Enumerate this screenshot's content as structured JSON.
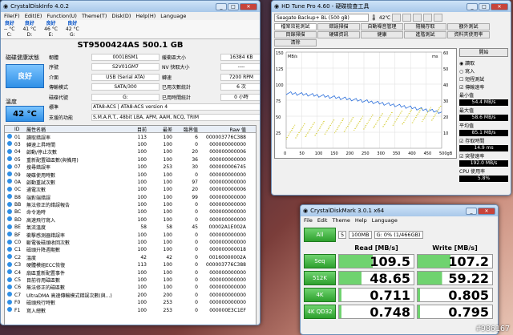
{
  "cdi": {
    "title": "CrystalDiskInfo 4.0.2",
    "menu": [
      "File(F)",
      "Edit(E)",
      "Function(U)",
      "Theme(T)",
      "Disk(D)",
      "Help(H)",
      "Language"
    ],
    "drives": [
      {
        "status": "良好",
        "temp": "-- °C",
        "letter": "C:"
      },
      {
        "status": "良好",
        "temp": "41 °C",
        "letter": "D:"
      },
      {
        "status": "良好",
        "temp": "46 °C",
        "letter": "E:"
      },
      {
        "status": "良好",
        "temp": "42 °C",
        "letter": "G:"
      }
    ],
    "model": "ST9500424AS  500.1 GB",
    "health_label": "磁碟健康狀態",
    "health": "良好",
    "temp_label": "溫度",
    "temp": "42 °C",
    "fields": [
      [
        "韌體",
        "0001BSM1",
        "緩衝區大小",
        "16384 KB"
      ],
      [
        "序號",
        "S2V01GM7",
        "NV 快取大小",
        "----"
      ],
      [
        "介面",
        "USB (Serial ATA)",
        "轉速",
        "7200 RPM"
      ],
      [
        "傳輸模式",
        "SATA/300",
        "已用次數統計",
        "6 次"
      ],
      [
        "磁碟代號",
        "G:",
        "已用時間統計",
        "0 小時"
      ]
    ],
    "standard_label": "標準",
    "standard": "ATA8-ACS | ATA8-ACS version 4",
    "features_label": "支援的功能",
    "features": "S.M.A.R.T., 48bit LBA, APM, AAM, NCQ, TRIM",
    "cols": [
      "",
      "ID",
      "屬性名稱",
      "目前",
      "最差",
      "臨界值",
      "Raw 值"
    ],
    "rows": [
      [
        "01",
        "讀取錯誤率",
        "113",
        "100",
        "6",
        "000003776C388"
      ],
      [
        "03",
        "轉速上昇時間",
        "100",
        "100",
        "0",
        "000000000000"
      ],
      [
        "04",
        "啟動/停止次數",
        "100",
        "100",
        "20",
        "000000000006"
      ],
      [
        "05",
        "重新配置磁區數(與備用)",
        "100",
        "100",
        "36",
        "000000000000"
      ],
      [
        "07",
        "搜尋錯誤率",
        "100",
        "253",
        "30",
        "000000006745"
      ],
      [
        "09",
        "硬碟使用時數",
        "100",
        "100",
        "0",
        "000000000000"
      ],
      [
        "0A",
        "啟動重試次數",
        "100",
        "100",
        "97",
        "000000000000"
      ],
      [
        "0C",
        "通電次數",
        "100",
        "100",
        "20",
        "000000000006"
      ],
      [
        "B8",
        "端對端錯誤",
        "100",
        "100",
        "99",
        "000000000000"
      ],
      [
        "BB",
        "無法修正的錯誤報告",
        "100",
        "100",
        "0",
        "000000000000"
      ],
      [
        "BC",
        "命令逾時",
        "100",
        "100",
        "0",
        "000000000000"
      ],
      [
        "BD",
        "高速飛行寫入",
        "100",
        "100",
        "0",
        "000000000000"
      ],
      [
        "BE",
        "氣流溫度",
        "58",
        "58",
        "45",
        "00002A1E002A"
      ],
      [
        "BF",
        "衝擊感測器錯誤率",
        "100",
        "100",
        "0",
        "000000000000"
      ],
      [
        "C0",
        "斷電後磁頭收回次數",
        "100",
        "100",
        "0",
        "000000000000"
      ],
      [
        "C1",
        "磁頭升降週期數",
        "100",
        "100",
        "0",
        "000000000018"
      ],
      [
        "C2",
        "溫度",
        "42",
        "42",
        "0",
        "00160000002A"
      ],
      [
        "C3",
        "硬體模組ECC恢復",
        "113",
        "100",
        "0",
        "000003776C388"
      ],
      [
        "C4",
        "扇區重新配置事件",
        "100",
        "100",
        "0",
        "000000000000"
      ],
      [
        "C5",
        "目前待用磁區數",
        "100",
        "100",
        "0",
        "000000000000"
      ],
      [
        "C6",
        "無法修正的磁區數",
        "100",
        "100",
        "0",
        "000000000000"
      ],
      [
        "C7",
        "UltraDMA 高速傳輸模式錯誤次數(與...)",
        "200",
        "200",
        "0",
        "000000000000"
      ],
      [
        "F0",
        "磁頭飛行時數",
        "100",
        "253",
        "0",
        "000000000000"
      ],
      [
        "F1",
        "寫入總數",
        "100",
        "253",
        "0",
        "000000E3C1EF"
      ]
    ]
  },
  "hdt": {
    "title": "HD Tune Pro 4.60 - 硬碟檢查工具",
    "drive": "Seagate Backup+ BL     (500 gB)",
    "temp": "42℃",
    "tabs": [
      "檔案效能測試",
      "錯誤掃描",
      "自動噪音管理",
      "隨機存取",
      "額外測試",
      "目錄掃描",
      "硬碟資訊",
      "健康",
      "進階測試",
      "資料夾使用率",
      "清除"
    ],
    "start": "開始",
    "read": "讀取",
    "write": "寫入",
    "short": "短程測試",
    "opts": [
      "傳輸速率",
      "平均速率",
      "存取時間",
      "突發速率",
      "CPU 使用率"
    ],
    "stats": [
      "54.4 MB/s",
      "58.6 MB/s",
      "85.1 MB/s",
      "14.9 ms",
      "192.0 MB/s",
      "5.8%"
    ],
    "stat_labels": [
      "最小值",
      "最大值",
      "平均值",
      "存取時間",
      "突發速率",
      "CPU 使用率"
    ],
    "y_ticks": [
      "150",
      "125",
      "100",
      "75",
      "50",
      "25"
    ],
    "x_ticks": [
      "0",
      "50",
      "100",
      "150",
      "200",
      "250",
      "300",
      "350",
      "400",
      "450",
      "500gB"
    ],
    "y_unit": "MB/s",
    "ms_ticks": [
      "60",
      "50",
      "40",
      "30",
      "20",
      "10"
    ],
    "ms_unit": "ms"
  },
  "cdm": {
    "title": "CrystalDiskMark 3.0.1 x64",
    "menu": [
      "File",
      "Edit",
      "Theme",
      "Help",
      "Language"
    ],
    "count": "5",
    "size": "100MB",
    "drive": "G: 0% (1/466GB)",
    "all": "All",
    "read_h": "Read [MB/s]",
    "write_h": "Write [MB/s]",
    "tests": [
      {
        "name": "Seq",
        "read": "109.5",
        "write": "107.2"
      },
      {
        "name": "512K",
        "read": "48.65",
        "write": "59.22"
      },
      {
        "name": "4K",
        "read": "0.711",
        "write": "0.805"
      },
      {
        "name": "4K QD32",
        "read": "0.748",
        "write": "0.795"
      }
    ]
  },
  "watermark": "#986167"
}
